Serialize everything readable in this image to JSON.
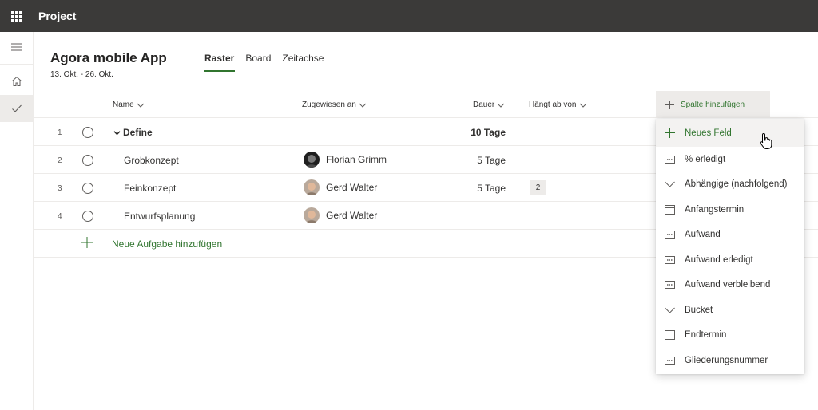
{
  "app": {
    "title": "Project"
  },
  "plan": {
    "name": "Agora mobile App",
    "dates": "13. Okt. - 26. Okt."
  },
  "tabs": [
    {
      "label": "Raster",
      "active": true
    },
    {
      "label": "Board",
      "active": false
    },
    {
      "label": "Zeitachse",
      "active": false
    }
  ],
  "columns": {
    "name": "Name",
    "assigned": "Zugewiesen an",
    "duration": "Dauer",
    "depends": "Hängt ab von",
    "add_column": "Spalte hinzufügen"
  },
  "rows": [
    {
      "num": "1",
      "name": "Define",
      "assignee": "",
      "duration": "10 Tage",
      "depends": ""
    },
    {
      "num": "2",
      "name": "Grobkonzept",
      "assignee": "Florian Grimm",
      "duration": "5 Tage",
      "depends": ""
    },
    {
      "num": "3",
      "name": "Feinkonzept",
      "assignee": "Gerd Walter",
      "duration": "5 Tage",
      "depends": "2"
    },
    {
      "num": "4",
      "name": "Entwurfsplanung",
      "assignee": "Gerd Walter",
      "duration": "",
      "depends": ""
    }
  ],
  "add_task": "Neue Aufgabe hinzufügen",
  "menu": {
    "items": [
      {
        "label": "Neues Feld",
        "icon": "plus-icon"
      },
      {
        "label": "% erledigt",
        "icon": "number-field-icon"
      },
      {
        "label": "Abhängige (nachfolgend)",
        "icon": "chevron-down-icon"
      },
      {
        "label": "Anfangstermin",
        "icon": "calendar-icon"
      },
      {
        "label": "Aufwand",
        "icon": "number-field-icon"
      },
      {
        "label": "Aufwand erledigt",
        "icon": "number-field-icon"
      },
      {
        "label": "Aufwand verbleibend",
        "icon": "number-field-icon"
      },
      {
        "label": "Bucket",
        "icon": "chevron-down-icon"
      },
      {
        "label": "Endtermin",
        "icon": "calendar-icon"
      },
      {
        "label": "Gliederungsnummer",
        "icon": "number-field-icon"
      }
    ]
  },
  "colors": {
    "accent": "#31752f",
    "topbar": "#3b3a39",
    "hover": "#edebe9"
  }
}
